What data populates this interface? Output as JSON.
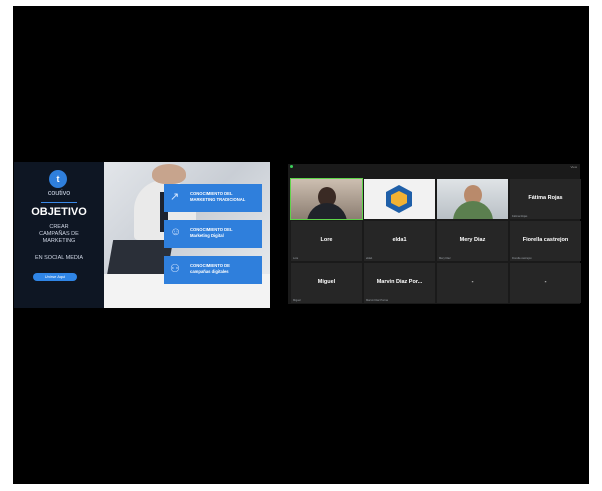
{
  "slide": {
    "logo_glyph": "t",
    "brand": "coutivo",
    "objective": "OBJETIVO",
    "crear_lines": [
      "CREAR",
      "CAMPAÑAS DE",
      "MARKETING"
    ],
    "social": "EN SOCIAL MEDIA",
    "button": "Unirse Aqui",
    "cards": [
      {
        "icon": "chart-icon",
        "glyph": "↗",
        "lines": [
          "CONOCIMIENTO DEL",
          "MARKETING TRADICIONAL"
        ]
      },
      {
        "icon": "person-icon",
        "glyph": "☺",
        "lines": [
          "CONOCIMIENTO DEL",
          "Marketing Digital"
        ]
      },
      {
        "icon": "network-icon",
        "glyph": "⚇",
        "lines": [
          "CONOCIMIENTO DE",
          "campañas digitales"
        ]
      }
    ],
    "colors": {
      "dark": "#0e1623",
      "accent": "#2f7fdc"
    }
  },
  "gallery": {
    "view_label": "View",
    "tiles": [
      {
        "id": "cam1",
        "name": "",
        "label": "",
        "video": true,
        "speaker": true
      },
      {
        "id": "cam2",
        "name": "",
        "label": "",
        "video": true,
        "logo": true
      },
      {
        "id": "cam3",
        "name": "",
        "label": "",
        "video": true
      },
      {
        "id": "fatima",
        "name": "Fátima Rojas",
        "label": "Fátima Rojas"
      },
      {
        "id": "lore",
        "name": "Lore",
        "label": "Lore"
      },
      {
        "id": "elda",
        "name": "elda1",
        "label": "elda1"
      },
      {
        "id": "mery",
        "name": "Mery Diaz",
        "label": "Mery Diaz"
      },
      {
        "id": "fiorella",
        "name": "Fiorella castrejon",
        "label": "Fiorella castrejon"
      },
      {
        "id": "miguel",
        "name": "Miguel",
        "label": "Miguel"
      },
      {
        "id": "marvin",
        "name": "Marvin Diaz Por...",
        "label": "Marvin Diaz Porras"
      },
      {
        "id": "p11",
        "name": "-",
        "label": ""
      },
      {
        "id": "p12",
        "name": "-",
        "label": ""
      }
    ]
  }
}
